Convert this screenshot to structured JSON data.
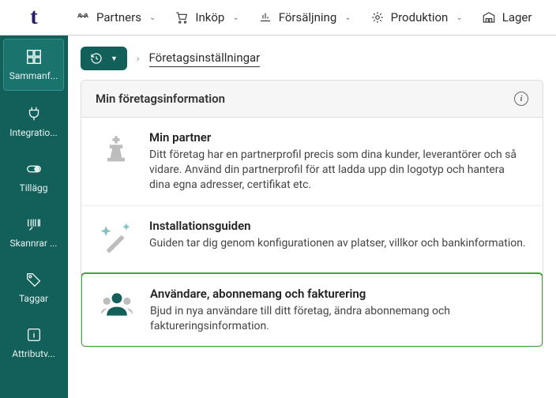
{
  "logo": "t",
  "topnav": [
    {
      "label": "Partners"
    },
    {
      "label": "Inköp"
    },
    {
      "label": "Försäljning"
    },
    {
      "label": "Produktion"
    },
    {
      "label": "Lager"
    }
  ],
  "sidebar": [
    {
      "label": "Sammanf..."
    },
    {
      "label": "Integratio..."
    },
    {
      "label": "Tillägg"
    },
    {
      "label": "Skannrar ..."
    },
    {
      "label": "Taggar"
    },
    {
      "label": "Attributv..."
    }
  ],
  "breadcrumb": "Företagsinställningar",
  "section": {
    "title": "Min företagsinformation",
    "cards": [
      {
        "title": "Min partner",
        "text": "Ditt företag har en partnerprofil precis som dina kunder, leverantörer och så vidare. Använd din partnerprofil för att ladda upp din logotyp och hantera dina egna adresser, certifikat etc."
      },
      {
        "title": "Installationsguiden",
        "text": "Guiden tar dig genom konfigurationen av platser, villkor och bankinformation."
      },
      {
        "title": "Användare, abonnemang och fakturering",
        "text": "Bjud in nya användare till ditt företag, ändra abonnemang och faktureringsinformation."
      }
    ]
  }
}
